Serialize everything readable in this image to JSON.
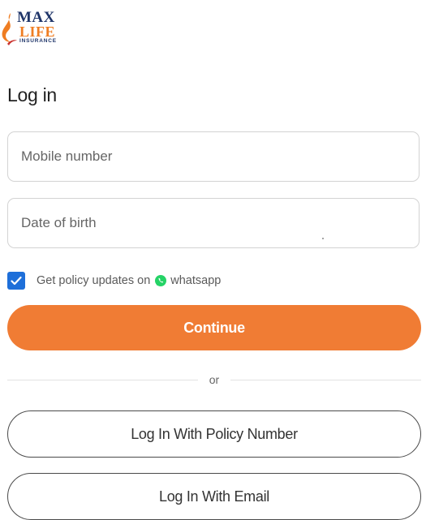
{
  "brand": {
    "line1": "MAX",
    "line2": "LIFE",
    "line3": "INSURANCE",
    "primary_color": "#1f3569",
    "accent_color": "#ef7d22"
  },
  "page": {
    "title": "Log in"
  },
  "form": {
    "mobile_placeholder": "Mobile number",
    "mobile_value": "",
    "dob_placeholder": "Date of birth",
    "dob_value": "",
    "consent_checked": true,
    "consent_text": "Get policy updates on",
    "consent_channel": "whatsapp",
    "continue_label": "Continue"
  },
  "divider": {
    "label": "or"
  },
  "alt_logins": {
    "policy_label": "Log In With Policy Number",
    "email_label": "Log In With Email"
  },
  "icons": {
    "flame": "max-life-flame-icon",
    "check": "checkmark-icon",
    "whatsapp": "whatsapp-icon"
  },
  "colors": {
    "continue_bg": "#f07c34",
    "checkbox_bg": "#1e6fd9",
    "whatsapp_green": "#25d366"
  }
}
